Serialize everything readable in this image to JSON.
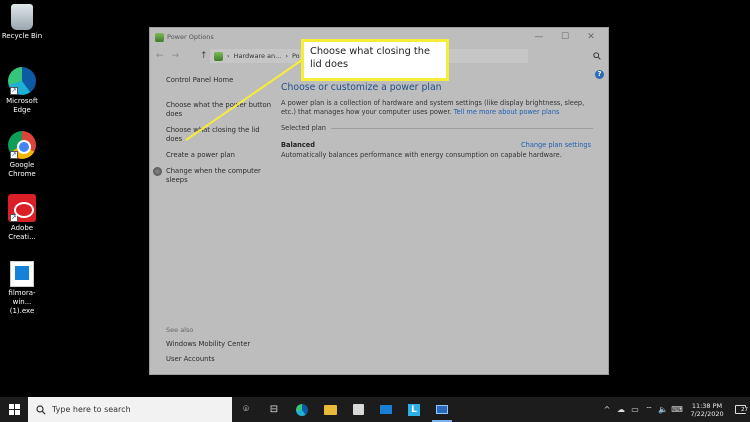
{
  "desktop": {
    "icons": [
      {
        "label": "Recycle Bin"
      },
      {
        "label": "Microsoft Edge"
      },
      {
        "label": "Google Chrome"
      },
      {
        "label": "Adobe Creati..."
      },
      {
        "label": "filmora-win... (1).exe"
      }
    ]
  },
  "window": {
    "title": "Power Options",
    "controls": {
      "minimize": "—",
      "maximize": "☐",
      "close": "✕"
    },
    "address": {
      "back": "←",
      "forward": "→",
      "up": "↑",
      "crumb_1": "Hardware an...",
      "crumb_2": "Po",
      "separator": "›"
    },
    "help": "?",
    "left_pane": {
      "home": "Control Panel Home",
      "links": [
        "Choose what the power button does",
        "Choose what closing the lid does",
        "Create a power plan",
        "Change when the computer sleeps"
      ],
      "see_also_heading": "See also",
      "see_also": [
        "Windows Mobility Center",
        "User Accounts"
      ]
    },
    "main": {
      "heading": "Choose or customize a power plan",
      "description": "A power plan is a collection of hardware and system settings (like display brightness, sleep, etc.) that manages how your computer uses power.",
      "description_link": "Tell me more about power plans",
      "selected_plan_label": "Selected plan",
      "plan": {
        "name": "Balanced",
        "description": "Automatically balances performance with energy consumption on capable hardware.",
        "change_link": "Change plan settings"
      }
    }
  },
  "callout": {
    "text": "Choose what closing the lid does",
    "color": "#f6ed3a"
  },
  "taskbar": {
    "search_placeholder": "Type here to search",
    "task_view": "⌾",
    "widgets": "⊟",
    "tray": {
      "chevron": "^",
      "time": "11:38 PM",
      "date": "7/22/2020",
      "notification_count": "27"
    }
  }
}
